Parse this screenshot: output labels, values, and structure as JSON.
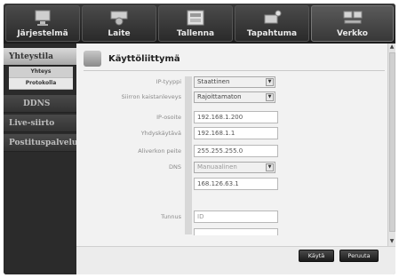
{
  "tabs": [
    {
      "label": "Järjestelmä",
      "icon": "monitor-icon"
    },
    {
      "label": "Laite",
      "icon": "camera-icon"
    },
    {
      "label": "Tallenna",
      "icon": "record-icon"
    },
    {
      "label": "Tapahtuma",
      "icon": "event-icon"
    },
    {
      "label": "Verkko",
      "icon": "network-icon"
    }
  ],
  "sidebar": {
    "sections": [
      "Yhteystila",
      "DDNS",
      "Live-siirto",
      "Postituspalvelu"
    ],
    "subitems": [
      "Yhteys",
      "Protokolla"
    ]
  },
  "panel": {
    "title": "Käyttöliittymä",
    "labels": {
      "ip_type": "IP-tyyppi",
      "bandwidth": "Siirron kaistanleveys",
      "ip_address": "IP-osoite",
      "gateway": "Yhdyskäytävä",
      "subnet": "Aliverkon peite",
      "dns": "DNS",
      "username": "Tunnus"
    },
    "values": {
      "ip_type": "Staattinen",
      "bandwidth": "Rajoittamaton",
      "ip_address": "192.168.1.200",
      "gateway": "192.168.1.1",
      "subnet": "255.255.255.0",
      "dns_mode": "Manuaalinen",
      "dns_server": "168.126.63.1",
      "username": "ID"
    },
    "buttons": {
      "apply": "Käytä",
      "cancel": "Peruuta"
    }
  }
}
